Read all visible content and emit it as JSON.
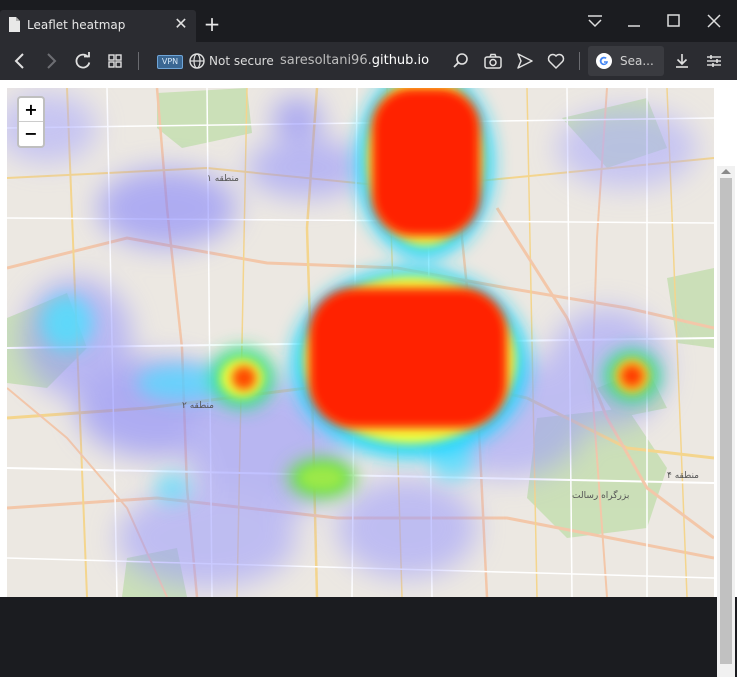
{
  "browser": {
    "tab_title": "Leaflet heatmap",
    "vpn_label": "VPN",
    "security_label": "Not secure",
    "url_prefix": "saresoltani96.",
    "url_domain": "github.io",
    "search_label": "Sea..."
  },
  "map": {
    "zoom_in_label": "+",
    "zoom_out_label": "−",
    "labels": [
      "منطقه ۱",
      "منطقه ۲",
      "منطقه ۴",
      "بزرگراه رسالت"
    ]
  }
}
